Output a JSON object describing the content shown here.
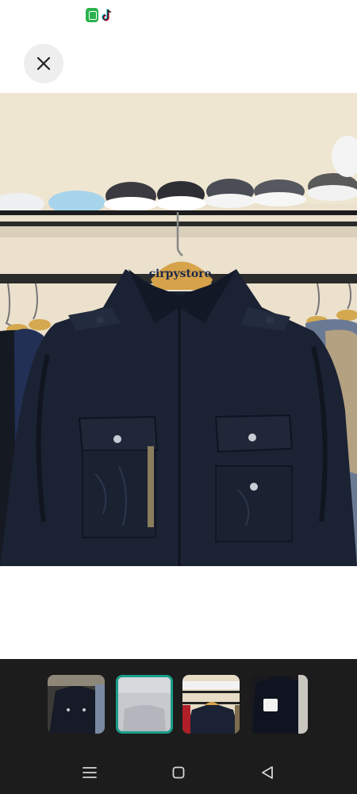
{
  "status_bar": {
    "notification_icons": [
      "green-app-icon",
      "tiktok-icon"
    ]
  },
  "viewer": {
    "close_icon": "close-icon",
    "photo": {
      "hanger_label": "cirpystore",
      "subject": "jacket-photo"
    }
  },
  "thumbnails": {
    "selected_index": 1,
    "items": [
      {
        "icon": "jacket-thumbnail"
      },
      {
        "icon": "blurred-thumbnail"
      },
      {
        "icon": "jacket-on-hanger-thumbnail"
      },
      {
        "icon": "jacket-with-tag-thumbnail"
      }
    ]
  },
  "nav_bar": {
    "buttons": [
      "menu-icon",
      "home-icon",
      "back-icon"
    ]
  },
  "colors": {
    "background": "#ffffff",
    "close_button_bg": "#eeeeee",
    "strip_bg": "#1c1c1c",
    "selected_border": "#1a9e8a",
    "jacket": "#1b2233"
  }
}
